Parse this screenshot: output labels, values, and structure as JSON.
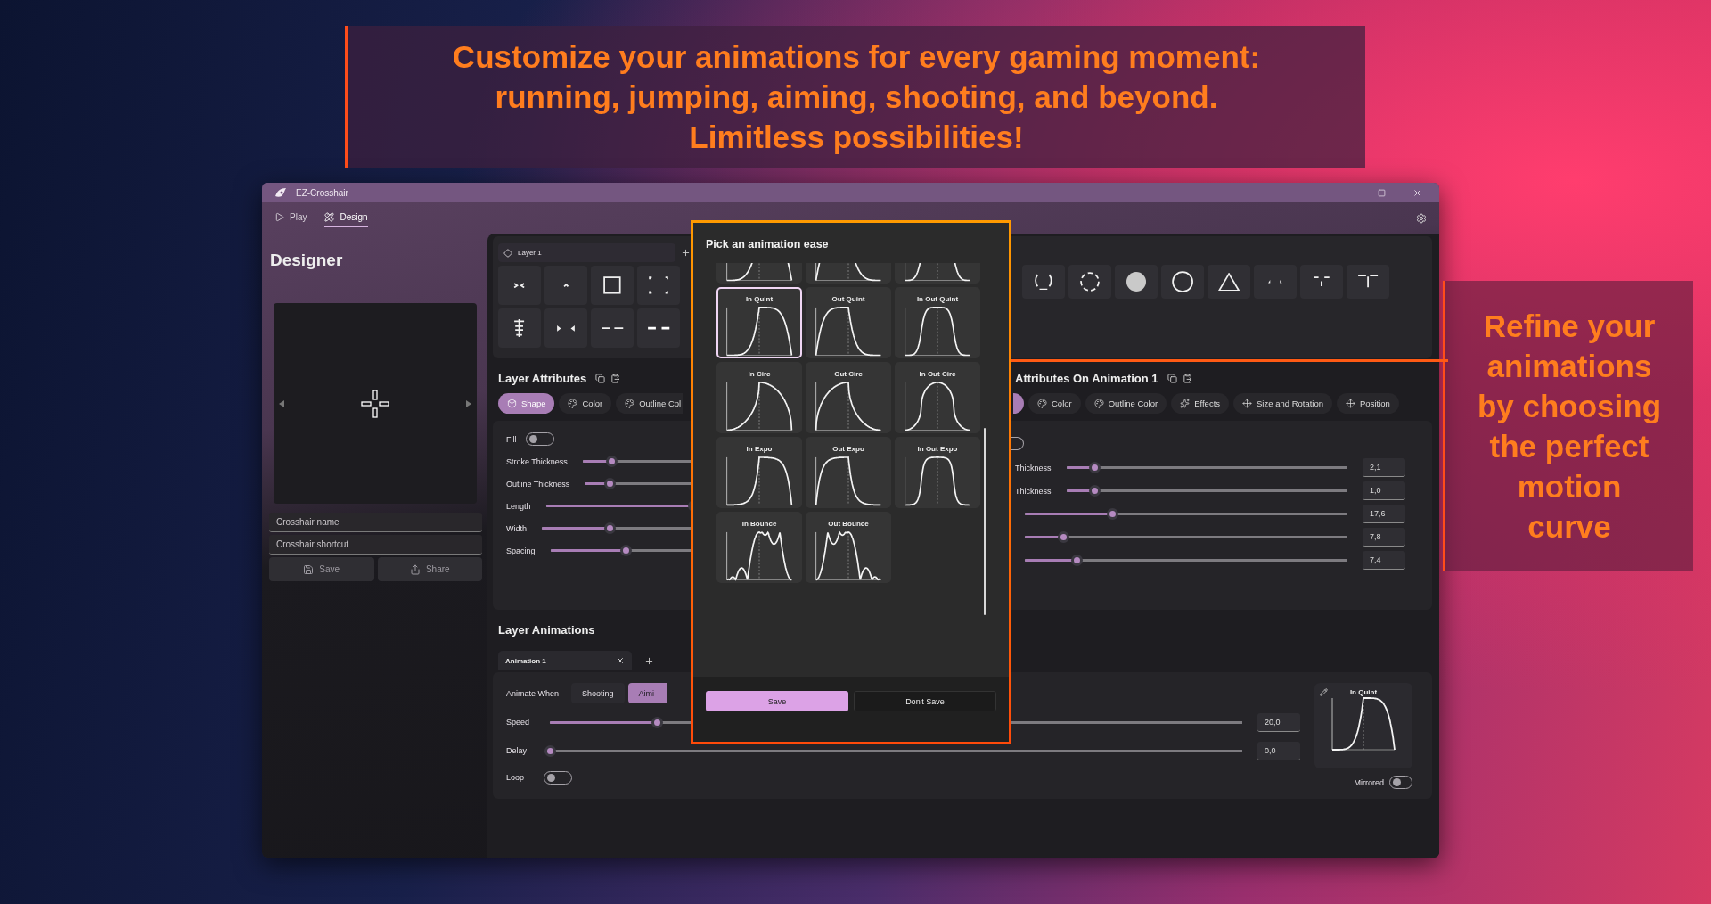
{
  "banner": {
    "lines": [
      "Customize your animations for every gaming moment:",
      "running, jumping, aiming, shooting, and beyond.",
      "Limitless possibilities!"
    ]
  },
  "callout": {
    "lines": [
      "Refine your",
      "animations",
      "by choosing",
      "the perfect",
      "motion",
      "curve"
    ]
  },
  "window": {
    "title": "EZ-Crosshair"
  },
  "nav": [
    {
      "label": "Play",
      "selected": false
    },
    {
      "label": "Design",
      "selected": true
    }
  ],
  "page_title": "Designer",
  "sidebar": {
    "fields": [
      {
        "placeholder": "Crosshair name"
      },
      {
        "placeholder": "Crosshair shortcut"
      }
    ],
    "buttons": [
      {
        "label": "Save"
      },
      {
        "label": "Share"
      }
    ]
  },
  "layer_tab": {
    "label": "Layer 1"
  },
  "shapes_left": [
    {
      "kind": "chevrons"
    },
    {
      "kind": "caret"
    },
    {
      "kind": "square"
    },
    {
      "kind": "corners"
    },
    {
      "kind": "ladder"
    },
    {
      "kind": "arrows"
    },
    {
      "kind": "dashes"
    },
    {
      "kind": "bars"
    }
  ],
  "shapes_right": [
    {
      "kind": "arc"
    },
    {
      "kind": "dashring"
    },
    {
      "kind": "disc"
    },
    {
      "kind": "ring"
    },
    {
      "kind": "triangle"
    },
    {
      "kind": "points"
    },
    {
      "kind": "tee"
    },
    {
      "kind": "longtee"
    }
  ],
  "layer_attributes": {
    "title": "Layer Attributes",
    "tabs": [
      {
        "label": "Shape",
        "selected": true
      },
      {
        "label": "Color",
        "selected": false
      },
      {
        "label": "Outline Col",
        "selected": false
      }
    ],
    "fill": {
      "label": "Fill",
      "on": false
    },
    "sliders": [
      {
        "label": "Stroke Thickness",
        "level": 0.07
      },
      {
        "label": "Outline Thickness",
        "level": 0.06
      },
      {
        "label": "Length",
        "level": 0.33
      },
      {
        "label": "Width",
        "level": 0.15
      },
      {
        "label": "Spacing",
        "level": 0.17
      }
    ]
  },
  "animation_attributes": {
    "title": "Attributes On Animation 1",
    "tabs": [
      {
        "selected": true
      },
      {
        "label": "Color",
        "selected": false
      },
      {
        "label": "Outline Color",
        "selected": false
      },
      {
        "label": "Effects",
        "selected": false
      },
      {
        "label": "Size and Rotation",
        "selected": false
      },
      {
        "label": "Position",
        "selected": false
      }
    ],
    "fill": {
      "on": false
    },
    "sliders": [
      {
        "label": "Thickness",
        "level": 0.1,
        "value": "2,1"
      },
      {
        "label": "Thickness",
        "level": 0.1,
        "value": "1,0"
      },
      {
        "level": 0.27,
        "value": "17,6"
      },
      {
        "level": 0.12,
        "value": "7,8"
      },
      {
        "level": 0.16,
        "value": "7,4"
      }
    ]
  },
  "layer_animations": {
    "title": "Layer Animations",
    "tabs": [
      {
        "label": "Animation 1",
        "selected": true
      }
    ],
    "animate_when": {
      "label": "Animate When",
      "options": [
        {
          "label": "Shooting",
          "selected": false
        },
        {
          "label": "Aimi",
          "selected": true
        }
      ]
    },
    "sliders": [
      {
        "label": "Speed",
        "level": 0.155,
        "value": "20,0"
      },
      {
        "label": "Delay",
        "level": 0,
        "value": "0,0"
      }
    ],
    "loop": {
      "label": "Loop",
      "on": false
    },
    "ease_preview": {
      "label": "In Quint"
    },
    "mirrored": {
      "label": "Mirrored",
      "on": false
    }
  },
  "ease_dialog": {
    "title": "Pick an animation ease",
    "eases": [
      {
        "selected": false
      },
      {
        "selected": false
      },
      {
        "selected": false
      },
      {
        "label": "In Quint",
        "selected": true
      },
      {
        "label": "Out Quint",
        "selected": false
      },
      {
        "label": "In Out Quint",
        "selected": false
      },
      {
        "label": "In Circ",
        "selected": false
      },
      {
        "label": "Out Circ",
        "selected": false
      },
      {
        "label": "In Out Circ",
        "selected": false
      },
      {
        "label": "In Expo",
        "selected": false
      },
      {
        "label": "Out Expo",
        "selected": false
      },
      {
        "label": "In Out Expo",
        "selected": false
      },
      {
        "label": "In Bounce",
        "selected": false
      },
      {
        "label": "Out Bounce",
        "selected": false
      }
    ],
    "buttons": [
      {
        "label": "Save",
        "kind": "primary"
      },
      {
        "label": "Don't Save",
        "kind": "secondary"
      }
    ]
  }
}
